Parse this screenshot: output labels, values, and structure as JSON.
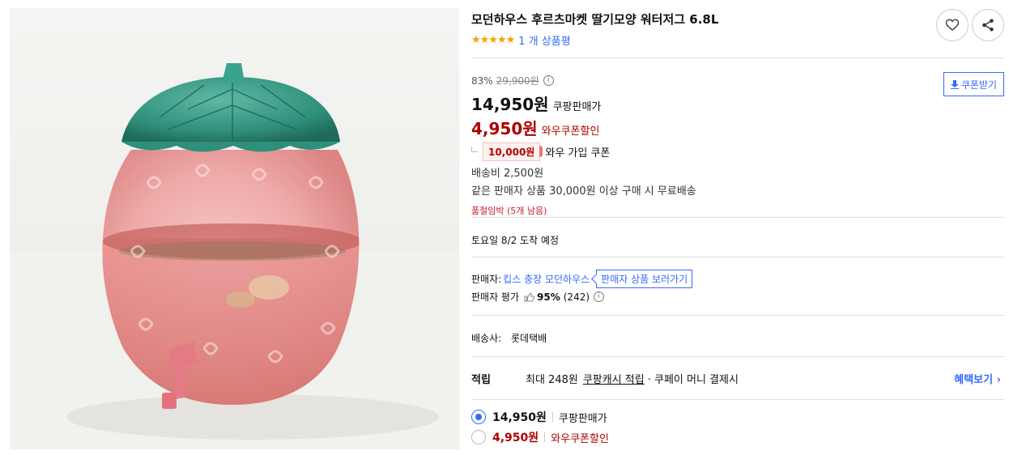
{
  "product": {
    "title": "모던하우스 후르츠마켓 딸기모양 워터저그 6.8L",
    "stars": "★★★★★",
    "review_count": "1 개 상품평",
    "rating_stars": 5
  },
  "actions": {
    "wishlist_icon": "heart-icon",
    "share_icon": "share-icon"
  },
  "price": {
    "discount_rate": "83%",
    "original_price": "29,900원",
    "info_icon": "i",
    "coupon_button": "쿠폰받기",
    "sale_price": "14,950원",
    "sale_label": "쿠팡판매가",
    "wow_price": "4,950원",
    "wow_label": "와우쿠폰할인",
    "join_coupon_amount": "10,000원",
    "join_coupon_label": "와우 가입 쿠폰"
  },
  "shipping": {
    "fee": "배송비 2,500원",
    "free_condition": "같은 판매자 상품 30,000원 이상 구매 시 무료배송",
    "stock_notice": "품절임박 (5개 남음)"
  },
  "delivery": {
    "eta": "토요일 8/2 도착 예정"
  },
  "seller": {
    "label": "판매자:",
    "name": "킵스 충장 모던하우스",
    "products_link": "판매자 상품 보러가기",
    "rating_label": "판매자 평가",
    "rating_pct": "95%",
    "rating_count": "(242)"
  },
  "courier": {
    "label": "배송사:",
    "name": "롯데택배"
  },
  "reward": {
    "title": "적립",
    "max": "최대 248원",
    "link": "쿠팡캐시 적립",
    "suffix": "· 쿠페이 머니 결제시",
    "benefit_link": "혜택보기 ›"
  },
  "options": [
    {
      "price": "14,950원",
      "label": "쿠팡판매가",
      "selected": true
    },
    {
      "price": "4,950원",
      "label": "와우쿠폰할인",
      "selected": false
    }
  ],
  "colors": {
    "accent_blue": "#346aff",
    "wow_red": "#ae0000",
    "star": "#f5a200"
  }
}
